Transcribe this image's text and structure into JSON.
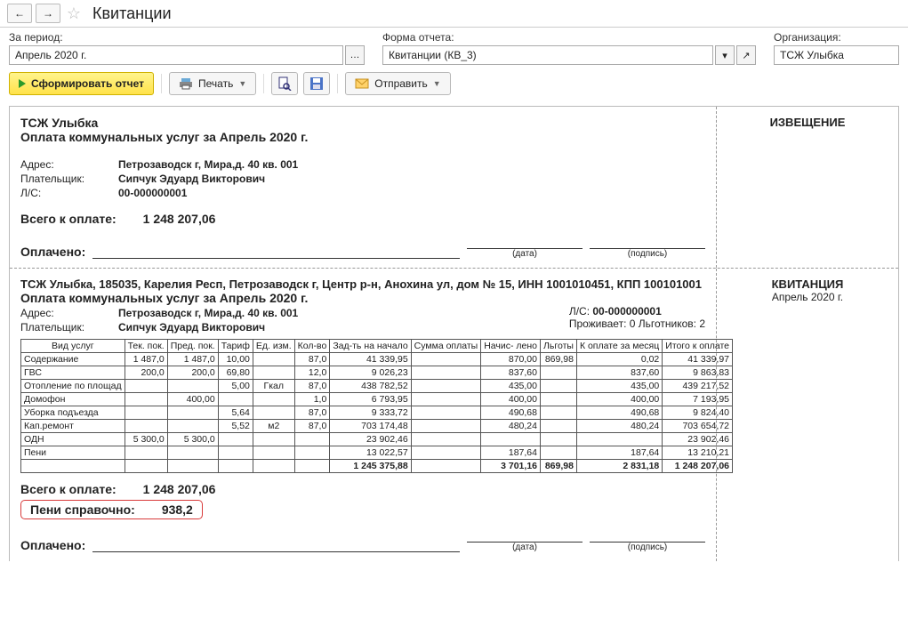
{
  "window": {
    "title": "Квитанции"
  },
  "filters": {
    "period_label": "За период:",
    "period_value": "Апрель 2020 г.",
    "form_label": "Форма отчета:",
    "form_value": "Квитанции (КВ_3)",
    "org_label": "Организация:",
    "org_value": "ТСЖ Улыбка"
  },
  "toolbar": {
    "generate": "Сформировать отчет",
    "print": "Печать",
    "send": "Отправить"
  },
  "notice": {
    "org": "ТСЖ Улыбка",
    "title": "Оплата коммунальных услуг за Апрель 2020 г.",
    "addr_lab": "Адрес:",
    "addr": "Петрозаводск г, Мира,д. 40 кв. 001",
    "payer_lab": "Плательщик:",
    "payer": "Сипчук Эдуард Викторович",
    "acc_lab": "Л/С:",
    "acc": "00-000000001",
    "total_lab": "Всего к оплате:",
    "total": "1 248 207,06",
    "paid_lab": "Оплачено:",
    "date_cap": "(дата)",
    "sign_cap": "(подпись)",
    "side": "ИЗВЕЩЕНИЕ"
  },
  "receipt": {
    "header": "ТСЖ Улыбка, 185035, Карелия Респ, Петрозаводск г, Центр р-н, Анохина ул, дом № 15, ИНН 1001010451, КПП 100101001",
    "title": "Оплата коммунальных услуг за Апрель 2020 г.",
    "addr_lab": "Адрес:",
    "addr": "Петрозаводск г, Мира,д. 40 кв. 001",
    "payer_lab": "Плательщик:",
    "payer": "Сипчук Эдуард Викторович",
    "acc_lab": "Л/С:",
    "acc": "00-000000001",
    "residents": "Проживает: 0 Льготников: 2",
    "side": "КВИТАНЦИЯ",
    "side_sub": "Апрель 2020 г.",
    "total_lab": "Всего к оплате:",
    "total": "1 248 207,06",
    "peni_lab": "Пени справочно:",
    "peni": "938,2",
    "paid_lab": "Оплачено:",
    "date_cap": "(дата)",
    "sign_cap": "(подпись)"
  },
  "table": {
    "headers": {
      "service": "Вид услуг",
      "cur": "Тек. пок.",
      "prev": "Пред. пок.",
      "tariff": "Тариф",
      "unit": "Ед. изм.",
      "qty": "Кол-во",
      "debt": "Зад-ть на начало",
      "paid": "Сумма оплаты",
      "accr": "Начис- лено",
      "disc": "Льготы",
      "month": "К оплате за месяц",
      "total": "Итого к оплате"
    },
    "rows": [
      {
        "service": "Содержание",
        "cur": "1 487,0",
        "prev": "1 487,0",
        "tariff": "10,00",
        "unit": "",
        "qty": "87,0",
        "debt": "41 339,95",
        "paid": "",
        "accr": "870,00",
        "disc": "869,98",
        "month": "0,02",
        "total": "41 339,97"
      },
      {
        "service": "ГВС",
        "cur": "200,0",
        "prev": "200,0",
        "tariff": "69,80",
        "unit": "",
        "qty": "12,0",
        "debt": "9 026,23",
        "paid": "",
        "accr": "837,60",
        "disc": "",
        "month": "837,60",
        "total": "9 863,83"
      },
      {
        "service": "Отопление по площад",
        "cur": "",
        "prev": "",
        "tariff": "5,00",
        "unit": "Гкал",
        "qty": "87,0",
        "debt": "438 782,52",
        "paid": "",
        "accr": "435,00",
        "disc": "",
        "month": "435,00",
        "total": "439 217,52"
      },
      {
        "service": "Домофон",
        "cur": "",
        "prev": "400,00",
        "tariff": "",
        "unit": "",
        "qty": "1,0",
        "debt": "6 793,95",
        "paid": "",
        "accr": "400,00",
        "disc": "",
        "month": "400,00",
        "total": "7 193,95"
      },
      {
        "service": "Уборка подъезда",
        "cur": "",
        "prev": "",
        "tariff": "5,64",
        "unit": "",
        "qty": "87,0",
        "debt": "9 333,72",
        "paid": "",
        "accr": "490,68",
        "disc": "",
        "month": "490,68",
        "total": "9 824,40"
      },
      {
        "service": "Кап.ремонт",
        "cur": "",
        "prev": "",
        "tariff": "5,52",
        "unit": "м2",
        "qty": "87,0",
        "debt": "703 174,48",
        "paid": "",
        "accr": "480,24",
        "disc": "",
        "month": "480,24",
        "total": "703 654,72"
      },
      {
        "service": "ОДН",
        "cur": "5 300,0",
        "prev": "5 300,0",
        "tariff": "",
        "unit": "",
        "qty": "",
        "debt": "23 902,46",
        "paid": "",
        "accr": "",
        "disc": "",
        "month": "",
        "total": "23 902,46"
      },
      {
        "service": "Пени",
        "cur": "",
        "prev": "",
        "tariff": "",
        "unit": "",
        "qty": "",
        "debt": "13 022,57",
        "paid": "",
        "accr": "187,64",
        "disc": "",
        "month": "187,64",
        "total": "13 210,21"
      }
    ],
    "totals": {
      "debt": "1 245 375,88",
      "paid": "",
      "accr": "3 701,16",
      "disc": "869,98",
      "month": "2 831,18",
      "total": "1 248 207,06"
    }
  }
}
